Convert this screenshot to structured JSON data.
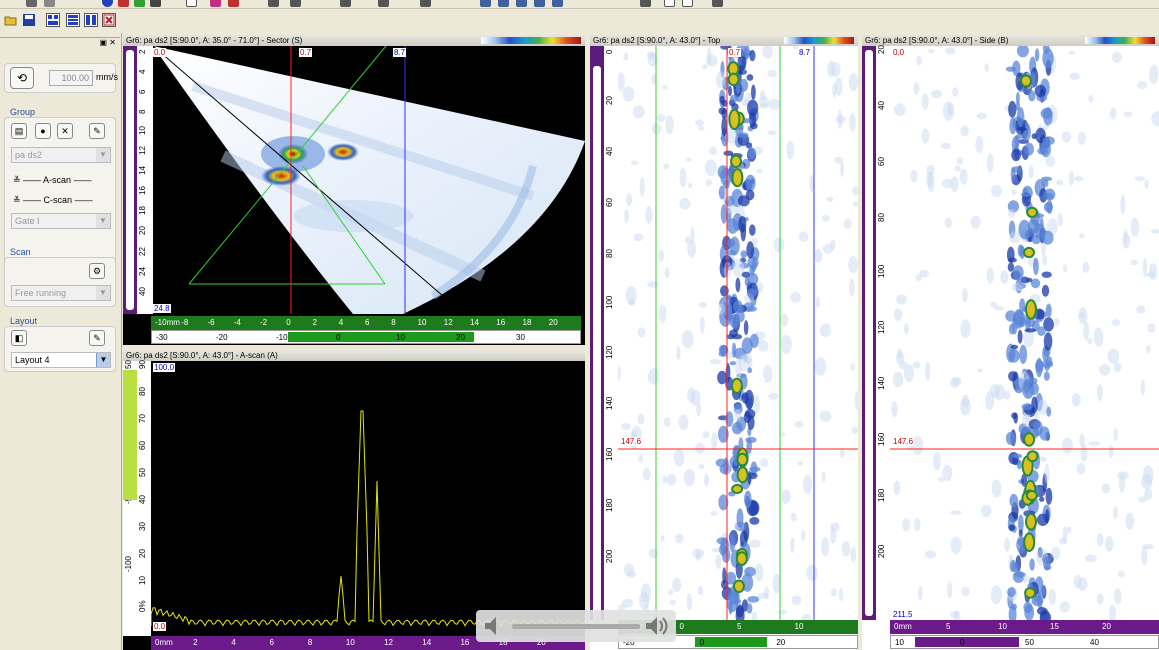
{
  "toolbar": {
    "icons": [
      "open-icon",
      "save-icon",
      "layout-grid-icon",
      "layout-rows-icon",
      "layout-cols-icon",
      "close-layout-icon"
    ]
  },
  "left_panel": {
    "speed_value": "100.00",
    "speed_unit": "mm/s",
    "group_label": "Group",
    "group_select": "pa ds2",
    "ascan_label": "A-scan",
    "cscan_label": "C-scan",
    "gate_select": "Gate I",
    "scan_label": "Scan",
    "scan_select": "Free running",
    "layout_label": "Layout",
    "layout_select": "Layout 4"
  },
  "views": {
    "sector": {
      "title": "Gr6: pa ds2 [S:90.0°, A: 35.0° - 71.0°] - Sector (S)",
      "corner_top": "0.0",
      "corner_bottom": "24.8",
      "cursor_red": "0.7",
      "cursor_blue": "8.7",
      "v_ticks": [
        "2",
        "4",
        "6",
        "8",
        "10",
        "12",
        "14",
        "16",
        "18",
        "20",
        "22",
        "24",
        "40"
      ],
      "h_ticks": [
        "-10mm",
        "-8",
        "-6",
        "-4",
        "-2",
        "0",
        "2",
        "4",
        "6",
        "8",
        "10",
        "12",
        "14",
        "16",
        "18",
        "20"
      ],
      "h2_ticks": [
        "-30",
        "-20",
        "-10",
        "0",
        "10",
        "20",
        "30"
      ]
    },
    "ascan": {
      "title": "Gr6: pa ds2 [S:90.0°, A: 43.0°] - A-scan (A)",
      "corner_top": "100.0",
      "corner_bottom": "0.0",
      "v_ticks": [
        "90",
        "80",
        "70",
        "60",
        "50",
        "40",
        "30",
        "20",
        "10",
        "0%"
      ],
      "v2_ticks": [
        "50",
        "0",
        "-50",
        "-100"
      ],
      "h_ticks": [
        "0mm",
        "2",
        "4",
        "6",
        "8",
        "10",
        "12",
        "14",
        "16",
        "18",
        "20"
      ]
    },
    "top": {
      "title": "Gr6: pa ds2 [S:90.0°, A: 43.0°] - Top",
      "cursor_red": "0.7",
      "cursor_blue": "8.7",
      "crosshair": "147.6",
      "v_ticks": [
        "0",
        "20",
        "40",
        "60",
        "80",
        "100",
        "120",
        "140",
        "160",
        "180",
        "200"
      ],
      "h_ticks": [
        "-5mm",
        "0",
        "5",
        "10"
      ],
      "h2_ticks": [
        "-20",
        "0",
        "20"
      ]
    },
    "side": {
      "title": "Gr6: pa ds2 [S:90.0°, A: 43.0°] - Side (B)",
      "corner_top": "0.0",
      "corner_bottom": "211.5",
      "crosshair": "147.6",
      "v_ticks": [
        "20",
        "40",
        "60",
        "80",
        "100",
        "120",
        "140",
        "160",
        "180",
        "200"
      ],
      "h_ticks": [
        "0mm",
        "5",
        "10",
        "15",
        "20"
      ],
      "h2_ticks": [
        "10",
        "0",
        "50",
        "40"
      ]
    }
  },
  "colors": {
    "ruler_purple": "#5a1e7a",
    "ruler_green": "#1d7a1d",
    "ascan_signal": "#e6e600",
    "cursor_red": "#ff2020",
    "cursor_blue": "#3030ff",
    "cursor_green": "#30d030"
  }
}
